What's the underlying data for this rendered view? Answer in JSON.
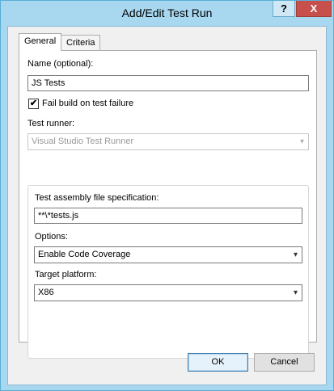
{
  "window": {
    "title": "Add/Edit Test Run",
    "help_glyph": "?",
    "close_glyph": "X"
  },
  "tabs": [
    {
      "label": "General",
      "active": true
    },
    {
      "label": "Criteria",
      "active": false
    }
  ],
  "general": {
    "name_label": "Name (optional):",
    "name_value": "JS Tests",
    "fail_build_label": "Fail build on test failure",
    "fail_build_checked": true,
    "checkmark_glyph": "✔",
    "test_runner_label": "Test runner:",
    "test_runner_value": "Visual Studio Test Runner",
    "test_runner_disabled": true,
    "assembly_spec_label": "Test assembly file specification:",
    "assembly_spec_value": "**\\*tests.js",
    "options_label": "Options:",
    "options_value": "Enable Code Coverage",
    "target_platform_label": "Target platform:",
    "target_platform_value": "X86",
    "dropdown_glyph": "▾"
  },
  "buttons": {
    "ok": "OK",
    "cancel": "Cancel"
  }
}
